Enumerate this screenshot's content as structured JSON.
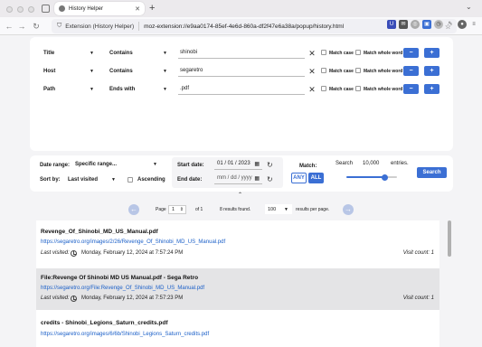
{
  "browser": {
    "tab_title": "History Helper",
    "url_site": "Extension (History Helper)",
    "url": "moz-extension://e9aa0174-85ef-4e6d-860a-df2f47e6a38a/popup/history.html"
  },
  "filters": [
    {
      "field": "Title",
      "operator": "Contains",
      "value": "shinobi",
      "match_case": "Match case",
      "whole_word": "Match whole word"
    },
    {
      "field": "Host",
      "operator": "Contains",
      "value": "segaretro",
      "match_case": "Match case",
      "whole_word": "Match whole word"
    },
    {
      "field": "Path",
      "operator": "Ends with",
      "value": ".pdf",
      "match_case": "Match case",
      "whole_word": "Match whole word"
    }
  ],
  "buttons": {
    "minus": "−",
    "plus": "+",
    "clear": "✕"
  },
  "options": {
    "date_range_label": "Date range:",
    "date_range_value": "Specific range...",
    "sort_label": "Sort by:",
    "sort_value": "Last visited",
    "ascending_label": "Ascending",
    "start_label": "Start date:",
    "start_value": "01 / 01 / 2023",
    "end_label": "End date:",
    "end_value": "mm / dd / yyyy",
    "match_label": "Match:",
    "any": "ANY",
    "all": "ALL",
    "search_label": "Search",
    "search_count": "10,000",
    "entries_label": "entries.",
    "slider_level": 0.75,
    "search_button": "Search"
  },
  "pagination": {
    "page_label": "Page",
    "page_value": "1",
    "of_label": "of 1",
    "results_found": "8 results found.",
    "per_page_value": "100",
    "per_page_label": "results per page."
  },
  "results": [
    {
      "title": "Revenge_Of_Shinobi_MD_US_Manual.pdf",
      "url": "https://segaretro.org/images/2/26/Revenge_Of_Shinobi_MD_US_Manual.pdf",
      "last_visited_label": "Last visited:",
      "date": "Monday, February 12, 2024 at 7:57:24 PM",
      "visit_count": "Visit count: 1"
    },
    {
      "title": "File:Revenge Of Shinobi MD US Manual.pdf - Sega Retro",
      "url": "https://segaretro.org/File:Revenge_Of_Shinobi_MD_US_Manual.pdf",
      "last_visited_label": "Last visited:",
      "date": "Monday, February 12, 2024 at 7:57:23 PM",
      "visit_count": "Visit count: 1"
    },
    {
      "title": "credits - Shinobi_Legions_Saturn_credits.pdf",
      "url": "https://segaretro.org/images/6/6b/Shinobi_Legions_Saturn_credits.pdf"
    }
  ],
  "colors": {
    "accent": "#3b6fd4",
    "link": "#1a5fc8",
    "highlight_row": "#e4e4e6"
  }
}
